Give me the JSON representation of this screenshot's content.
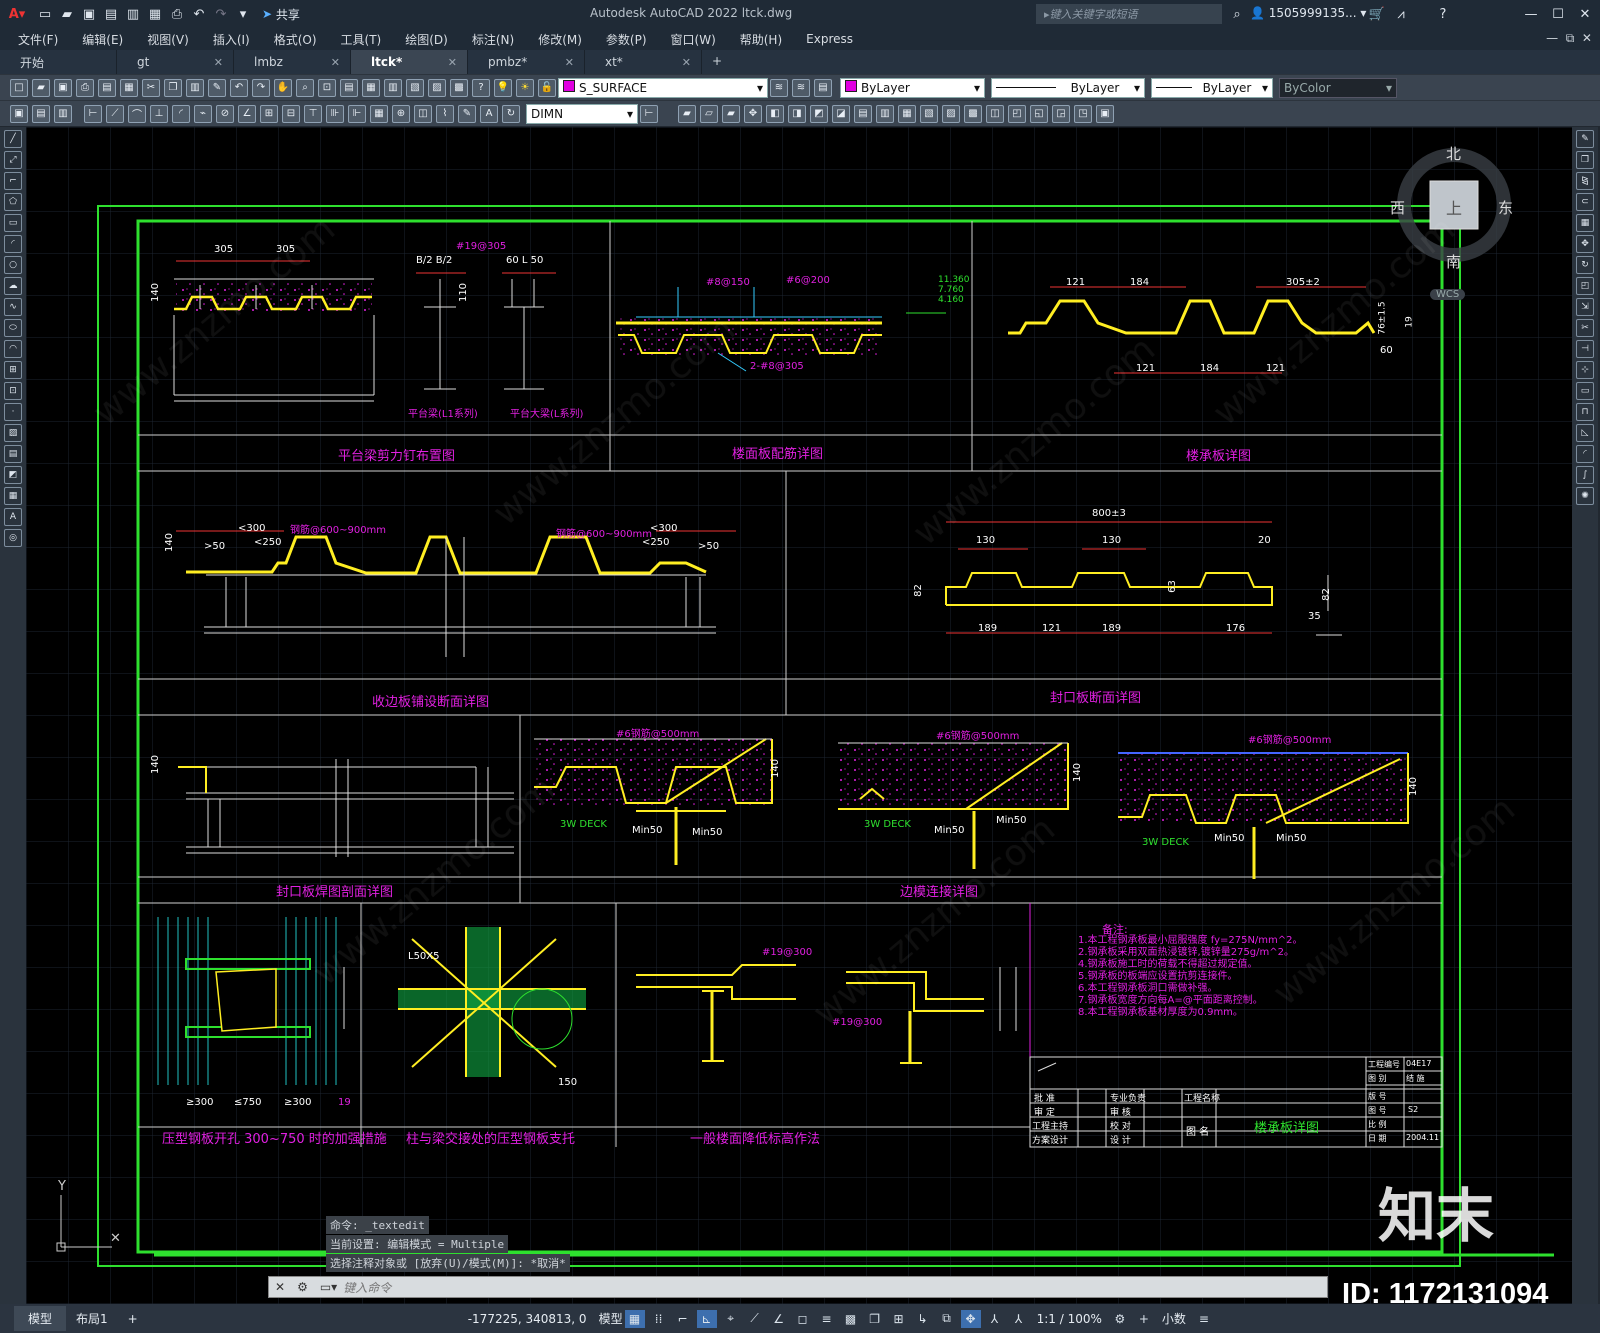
{
  "app": {
    "title": "Autodesk AutoCAD 2022    ltck.dwg",
    "search_placeholder": "键入关键字或短语",
    "user": "1505999135...",
    "share": "共享"
  },
  "menu": [
    "文件(F)",
    "编辑(E)",
    "视图(V)",
    "插入(I)",
    "格式(O)",
    "工具(T)",
    "绘图(D)",
    "标注(N)",
    "修改(M)",
    "参数(P)",
    "窗口(W)",
    "帮助(H)",
    "Express"
  ],
  "tabs": [
    "开始",
    "gt",
    "lmbz",
    "ltck*",
    "pmbz*",
    "xt*"
  ],
  "active_tab": 3,
  "layer": "S_SURFACE",
  "color": "ByLayer",
  "linetype": "ByLayer",
  "lineweight": "ByLayer",
  "plotstyle": "ByColor",
  "dimstyle": "DIMN",
  "viewcube": {
    "n": "北",
    "s": "南",
    "e": "东",
    "w": "西",
    "top": "上",
    "wcs": "WCS"
  },
  "drawing": {
    "sec1": "平台梁剪力钉布置图",
    "sec2": "楼面板配筋详图",
    "sec3": "楼承板详图",
    "sec4": "收边板铺设断面详图",
    "sec5": "封口板断面详图",
    "sec6": "封口板焊图剖面详图",
    "sec7": "边模连接详图",
    "sec8": "压型钢板开孔 300~750 时的加强措施",
    "sec9": "柱与梁交接处的压型钢板支托",
    "sec10": "一般楼面降低标高作法",
    "label_b2": "B/2 B/2",
    "label_l50": "60 L 50",
    "dim_305a": "305",
    "dim_305b": "305",
    "dim_140": "140",
    "dim_110": "110",
    "beam1": "平台梁(L1系列)",
    "beam2": "平台大梁(L系列)",
    "stud": "#19@305",
    "rebar1": "#8@150",
    "rebar2": "#6@200",
    "rebar3": "2-#8@305",
    "elev": "11.360\n7.760\n4.160",
    "d121": "121",
    "d184": "184",
    "d3052": "305±2",
    "d60": "60",
    "d76": "76±1.5",
    "d19": "19",
    "d800": "800±3",
    "d130": "130",
    "d20": "20",
    "d82": "82",
    "d63": "63",
    "d189": "189",
    "d176": "176",
    "d35": "35",
    "lt300": "<300",
    "lt250": "<250",
    "gt50": ">50",
    "spacing": "钢筋@600~900mm",
    "deck": "3W DECK",
    "min50": "Min50",
    "rebar500": "#6钢筋@500mm",
    "notes_title": "备注:",
    "notes": [
      "1.本工程钢承板最小屈服强度 fy=275N/mm^2。",
      "2.钢承板采用双面热浸镀锌,镀锌量275g/m^2。",
      "4.钢承板施工时的荷载不得超过规定值。",
      "5.钢承板的板端应设置抗剪连接件。",
      "6.本工程钢承板洞口需做补强。",
      "7.钢承板宽度方向每A=@平面距离控制。",
      "8.本工程钢承板基材厚度为0.9mm。"
    ],
    "tb_name": "楼承板详图",
    "tb_proj": "工程名称",
    "tb_no": "工程编号",
    "tb_date": "2004.11",
    "tb_code": "04E17",
    "tb_scale": "比例",
    "tb_rows": [
      "批 准",
      "审 定",
      "工程主持",
      "方案设计"
    ],
    "tb_rows2": [
      "专业负责",
      "审 核",
      "校 对",
      "设 计"
    ],
    "tb_right": [
      "工程编号",
      "图 别",
      "版 号",
      "图 号",
      "比 例",
      "日 期"
    ],
    "tb_right_vals": [
      "04E17",
      "结 施",
      "",
      "S2",
      "",
      "2004.11"
    ],
    "tb_figname": "图 名",
    "d750": "≤750",
    "d300": "≥300",
    "d19b": "#19@300",
    "lbl_L50": "L50X5",
    "d150": "150"
  },
  "cmd": {
    "history": [
      "命令: _textedit",
      "当前设置: 编辑模式 = Multiple",
      "选择注释对象或 [放弃(U)/模式(M)]: *取消*"
    ],
    "placeholder": "键入命令"
  },
  "status": {
    "tabs": [
      "模型",
      "布局1"
    ],
    "coords": "-177225, 340813, 0",
    "mode": "模型",
    "scale": "1:1 / 100%",
    "units": "小数"
  },
  "watermark": {
    "logo": "知末",
    "id": "ID: 1172131094"
  }
}
